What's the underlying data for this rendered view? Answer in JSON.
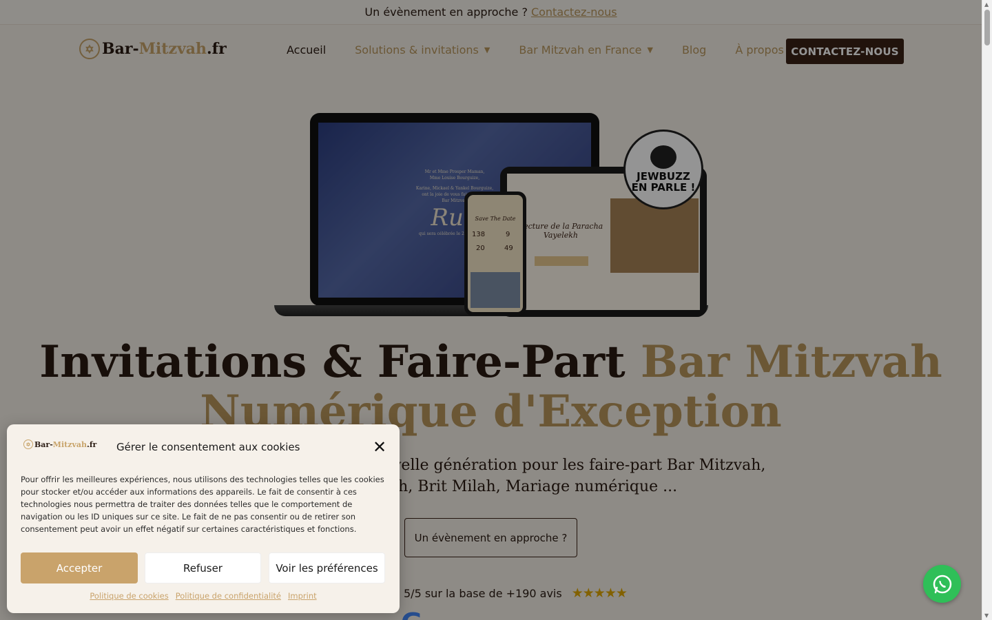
{
  "topbar": {
    "text": "Un évènement en approche ?",
    "link": "Contactez-nous"
  },
  "header": {
    "logo": {
      "part1": "Bar-",
      "part2": "Mitzvah",
      "part3": ".fr"
    },
    "nav": [
      {
        "label": "Accueil",
        "active": true,
        "dropdown": false
      },
      {
        "label": "Solutions & invitations",
        "active": false,
        "dropdown": true
      },
      {
        "label": "Bar Mitzvah en France",
        "active": false,
        "dropdown": true
      },
      {
        "label": "Blog",
        "active": false,
        "dropdown": false
      },
      {
        "label": "À propos",
        "active": false,
        "dropdown": false
      }
    ],
    "cta": "CONTACTEZ-NOUS"
  },
  "hero": {
    "mockup": {
      "laptop_line1": "Mr et Mme Prosper Maman,",
      "laptop_line2": "Mme Louise Bourguize,",
      "laptop_line3": "Karine, Mickael & Yankel Bourguize,",
      "laptop_line4": "ont la joie de vous faire part de",
      "laptop_line5": "Bar Mitzvah",
      "laptop_name": "Rub",
      "laptop_date": "qui sera célébrée le 29 septembre",
      "tablet_title": "Lecture de la Paracha Vayelekh",
      "phone_title": "Save The Date",
      "phone_counts": [
        "138",
        "9",
        "20",
        "49"
      ],
      "badge_line1": "JEWBUZZ",
      "badge_line2": "EN PARLE !"
    },
    "title_dark": "Invitations & Faire-Part ",
    "title_gold": "Bar Mitzvah Numérique d'Exception",
    "subtitle_line1": "velle génération pour les faire-part Bar Mitzvah,",
    "subtitle_line2": "ah, Brit Milah, Mariage numérique ...",
    "event_button": "Un évènement en approche ?",
    "rating_text": "5/5 sur la base de +190 avis",
    "rating_stars": "★★★★★",
    "google_partial": "G"
  },
  "cookie": {
    "logo": {
      "part1": "Bar-",
      "part2": "Mitzvah",
      "part3": ".fr"
    },
    "title": "Gérer le consentement aux cookies",
    "body": "Pour offrir les meilleures expériences, nous utilisons des technologies telles que les cookies pour stocker et/ou accéder aux informations des appareils. Le fait de consentir à ces technologies nous permettra de traiter des données telles que le comportement de navigation ou les ID uniques sur ce site. Le fait de ne pas consentir ou de retirer son consentement peut avoir un effet négatif sur certaines caractéristiques et fonctions.",
    "accept": "Accepter",
    "refuse": "Refuser",
    "preferences": "Voir les préférences",
    "links": [
      "Politique de cookies",
      "Politique de confidentialité",
      "Imprint"
    ]
  },
  "colors": {
    "gold": "#b8965c",
    "dark": "#2a1b12",
    "accept": "#c9a36b",
    "whatsapp": "#2fbf58"
  }
}
